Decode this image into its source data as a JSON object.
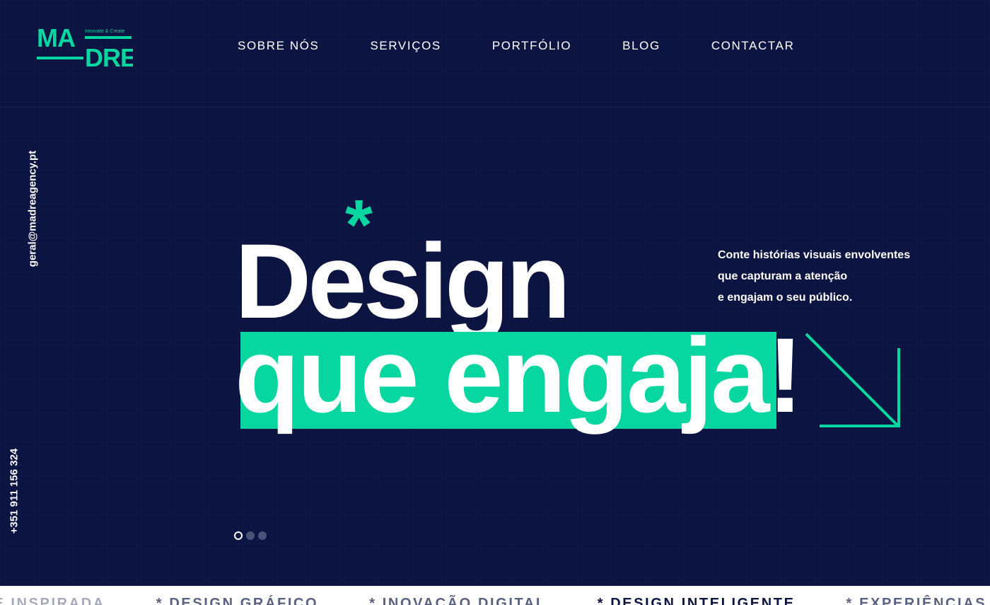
{
  "brand": {
    "logo_top": "MA",
    "logo_bottom": "DRE",
    "logo_tagline": "Innovate & Create",
    "accent_color": "#07d6a0",
    "background_color": "#0c1442"
  },
  "nav": {
    "items": [
      "SOBRE NÓS",
      "SERVIÇOS",
      "PORTFÓLIO",
      "BLOG",
      "CONTACTAR"
    ]
  },
  "contact": {
    "email": "geral@madreagency.pt",
    "phone": "+351 911 156 324"
  },
  "hero": {
    "asterisk": "*",
    "line1": "Design",
    "line2": "que engaja!",
    "tagline_lines": [
      "Conte histórias visuais envolventes",
      "que capturam a atenção",
      "e engajam o seu público."
    ],
    "arrow_icon": "arrow-down-right-icon"
  },
  "slider": {
    "total": 3,
    "active": 1
  },
  "marquee": {
    "items": [
      "IDADE INSPIRADA",
      "* DESIGN GRÁFICO",
      "* INOVAÇÃO DIGITAL",
      "* DESIGN INTELIGENTE",
      "* EXPERIÊNCIAS"
    ]
  }
}
